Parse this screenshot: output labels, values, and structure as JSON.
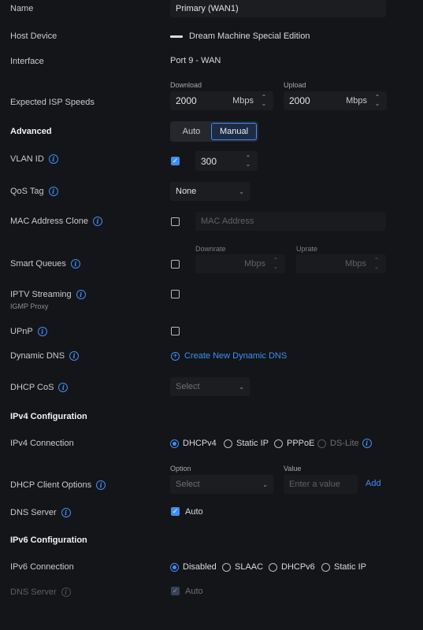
{
  "name": {
    "label": "Name",
    "value": "Primary (WAN1)"
  },
  "host_device": {
    "label": "Host Device",
    "value": "Dream Machine Special Edition"
  },
  "interface": {
    "label": "Interface",
    "value": "Port 9 - WAN"
  },
  "isp_speeds": {
    "label": "Expected ISP Speeds",
    "download": {
      "caption": "Download",
      "value": "2000",
      "unit": "Mbps"
    },
    "upload": {
      "caption": "Upload",
      "value": "2000",
      "unit": "Mbps"
    }
  },
  "advanced": {
    "label": "Advanced",
    "options": [
      "Auto",
      "Manual"
    ],
    "selected": "Manual"
  },
  "vlan": {
    "label": "VLAN ID",
    "checked": true,
    "value": "300"
  },
  "qos": {
    "label": "QoS Tag",
    "value": "None"
  },
  "mac_clone": {
    "label": "MAC Address Clone",
    "checked": false,
    "placeholder": "MAC Address"
  },
  "smart_queues": {
    "label": "Smart Queues",
    "checked": false,
    "downrate": {
      "caption": "Downrate",
      "unit": "Mbps"
    },
    "uprate": {
      "caption": "Uprate",
      "unit": "Mbps"
    }
  },
  "iptv": {
    "label": "IPTV Streaming",
    "sublabel": "IGMP Proxy",
    "checked": false
  },
  "upnp": {
    "label": "UPnP",
    "checked": false
  },
  "dynamic_dns": {
    "label": "Dynamic DNS",
    "link": "Create New Dynamic DNS"
  },
  "dhcp_cos": {
    "label": "DHCP CoS",
    "placeholder": "Select"
  },
  "ipv4_config": {
    "title": "IPv4 Configuration"
  },
  "ipv4_connection": {
    "label": "IPv4 Connection",
    "options": [
      "DHCPv4",
      "Static IP",
      "PPPoE",
      "DS-Lite"
    ],
    "selected": "DHCPv4"
  },
  "dhcp_client_options": {
    "label": "DHCP Client Options",
    "option_caption": "Option",
    "option_placeholder": "Select",
    "value_caption": "Value",
    "value_placeholder": "Enter a value",
    "add_label": "Add"
  },
  "dns_server_v4": {
    "label": "DNS Server",
    "checked": true,
    "value": "Auto"
  },
  "ipv6_config": {
    "title": "IPv6 Configuration"
  },
  "ipv6_connection": {
    "label": "IPv6 Connection",
    "options": [
      "Disabled",
      "SLAAC",
      "DHCPv6",
      "Static IP"
    ],
    "selected": "Disabled"
  },
  "dns_server_v6": {
    "label": "DNS Server",
    "checked": true,
    "value": "Auto",
    "disabled": true
  },
  "icons": {
    "info": "info-icon",
    "check": "check-icon",
    "chevron": "chevron-down-icon",
    "stepper": "stepper-icon",
    "device": "device-icon",
    "plus": "plus-circle-icon"
  },
  "colors": {
    "accent": "#3f8ef6",
    "background": "#141518",
    "field": "#1c1d21"
  }
}
